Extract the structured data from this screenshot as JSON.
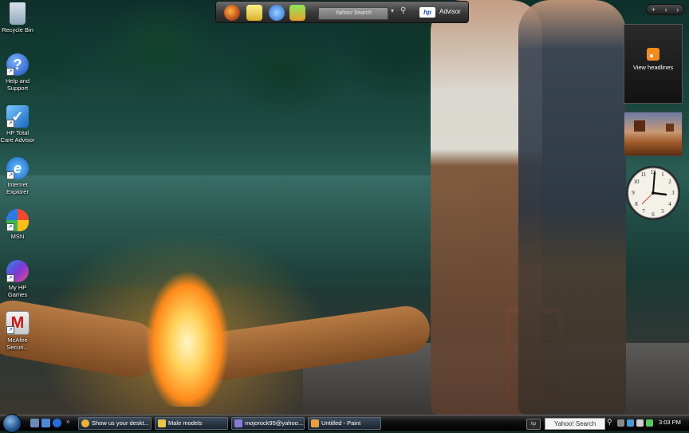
{
  "desktop": {
    "icons": [
      {
        "label": "Recycle Bin",
        "icon": "recycle-bin-icon"
      },
      {
        "label": "Help and\nSupport",
        "icon": "help-icon"
      },
      {
        "label": "HP Total\nCare Advisor",
        "icon": "hp-advisor-icon"
      },
      {
        "label": "Internet\nExplorer",
        "icon": "ie-icon"
      },
      {
        "label": "MSN",
        "icon": "msn-butterfly-icon"
      },
      {
        "label": "My HP\nGames",
        "icon": "hp-games-icon"
      },
      {
        "label": "McAfee\nSecuri...",
        "icon": "mcafee-icon"
      }
    ]
  },
  "toolbar": {
    "search_placeholder": "Yahoo! Search",
    "advisor_label": "Advisor",
    "hp_logo": "hp"
  },
  "sidebar": {
    "controls": [
      "+",
      "‹",
      "›"
    ],
    "feed_label": "View headlines"
  },
  "taskbar": {
    "tasks": [
      {
        "label": "Show us your deskt...",
        "icon_color": "#e8b33a"
      },
      {
        "label": "Male models",
        "icon_color": "#e8c64a"
      },
      {
        "label": "mojorock95@yahoo....",
        "icon_color": "#8a7ad8"
      },
      {
        "label": "Untitled - Paint",
        "icon_color": "#e8a03a"
      }
    ],
    "hp_tray": "hp",
    "search_label": "Yahoo! Search",
    "time": "3:03 PM"
  },
  "colors": {
    "taskbar": "#101010",
    "rss": "#f38a1d",
    "accent": "#1c4f86"
  }
}
